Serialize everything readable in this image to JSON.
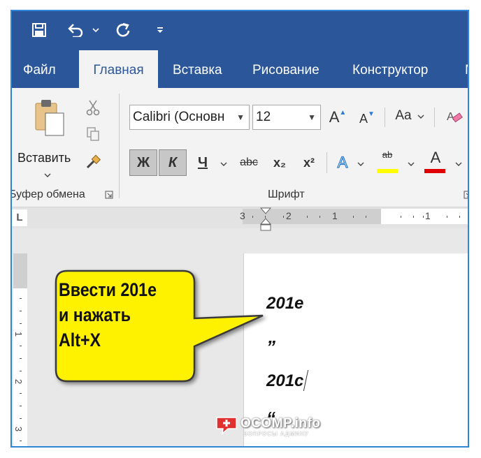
{
  "quick_access": {
    "save_icon": "floppy-disk-icon",
    "undo_icon": "undo-icon",
    "redo_icon": "redo-icon",
    "customize_icon": "customize-qat-icon"
  },
  "tabs": [
    {
      "label": "Файл"
    },
    {
      "label": "Главная"
    },
    {
      "label": "Вставка"
    },
    {
      "label": "Рисование"
    },
    {
      "label": "Конструктор"
    },
    {
      "label": "M"
    }
  ],
  "clipboard": {
    "paste_label": "Вставить",
    "group_label": "Буфер обмена"
  },
  "font": {
    "font_name": "Calibri (Основн",
    "font_size": "12",
    "grow_label": "A",
    "shrink_label": "A",
    "case_label": "Aa",
    "bold_label": "Ж",
    "italic_label": "К",
    "underline_label": "Ч",
    "strike_label": "abc",
    "subscript_label": "x₂",
    "superscript_label": "x²",
    "effects_label": "A",
    "highlight_label": "ab",
    "fontcolor_label": "A",
    "group_label": "Шрифт"
  },
  "colors": {
    "accent": "#2b579a",
    "highlight": "#ffff00",
    "font_color": "#e00000",
    "callout_fill": "#fff200",
    "frame": "#2f86d8"
  },
  "view_toggle": {
    "label": "L"
  },
  "ruler": {
    "labels": [
      "3",
      "2",
      "1",
      "1"
    ]
  },
  "vertical_ruler": {
    "labels": [
      "1",
      "2",
      "3"
    ]
  },
  "document": {
    "line1": "201e",
    "line2": "”",
    "line3": "201c",
    "line4": "“"
  },
  "callout": {
    "line1": "Ввести 201е",
    "line2": "и нажать",
    "line3": "Alt+X"
  },
  "watermark": {
    "title": "OCOMP.info",
    "subtitle": "ВОПРОСЫ АДМИНУ"
  }
}
